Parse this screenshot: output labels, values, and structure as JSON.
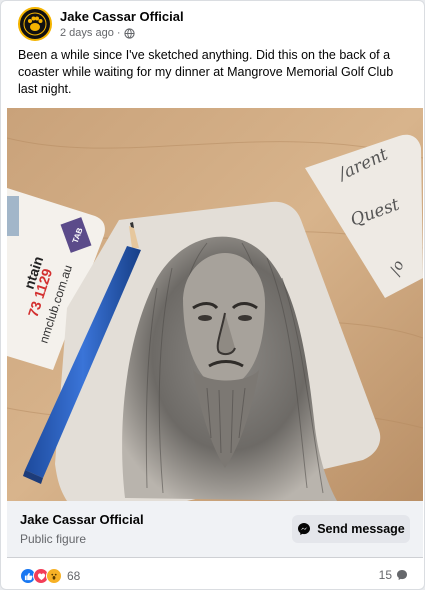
{
  "post": {
    "author": "Jake Cassar Official",
    "timestamp": "2 days ago",
    "separator": "·",
    "audience_icon": "globe-icon",
    "text": "Been a while since I've sketched anything. Did this on the back of a coaster while waiting for my dinner at Mangrove Memorial Golf Club last night."
  },
  "photo": {
    "coaster_left_text": {
      "line1": "ntain",
      "line2": "73 1129",
      "line3": "nmclub.com.au",
      "badge": "TAB"
    },
    "note_text": {
      "line1": "/arent",
      "line2": "Quest",
      "line3": "/o"
    }
  },
  "page_card": {
    "name": "Jake Cassar Official",
    "category": "Public figure",
    "button_label": "Send message",
    "button_icon": "messenger-icon"
  },
  "engagement": {
    "reaction_icons": [
      "like-icon",
      "love-icon",
      "wow-icon"
    ],
    "reaction_count": "68",
    "comment_count": "15",
    "comment_icon": "comment-icon"
  },
  "colors": {
    "like": "#1877f2",
    "love": "#f33e58",
    "wow": "#f7b125",
    "muted_text": "#65676b",
    "card_bg": "#f0f2f5",
    "button_bg": "#e4e6eb"
  }
}
